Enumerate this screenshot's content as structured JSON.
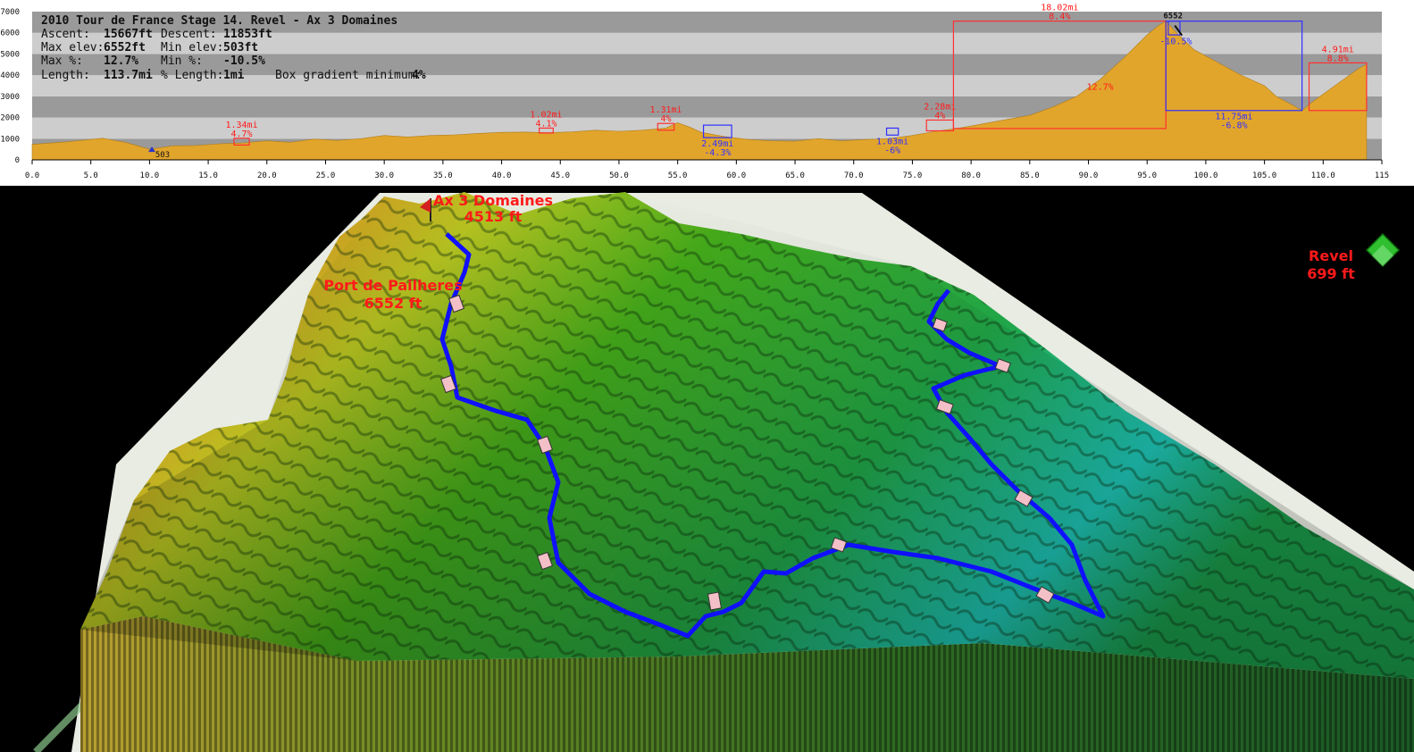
{
  "colors": {
    "profile_fill": "#e2a52c",
    "band_dark": "#9a9a9a",
    "band_light": "#cdcdcd",
    "climb_box": "#ff3030",
    "descent_box": "#3030ff",
    "label_red": "#ff1a1a",
    "route": "#1010ff"
  },
  "summary": {
    "ascent_label": "Ascent:",
    "ascent_value": "15667ft",
    "descent_label": "Descent:",
    "descent_value": "11853ft",
    "max_elev_label": "Max elev:",
    "max_elev_value": "6552ft",
    "min_elev_label": "Min elev:",
    "min_elev_value": "503ft",
    "max_pct_label": "Max %:",
    "max_pct_value": "12.7%",
    "min_pct_label": "Min %:",
    "min_pct_value": "-10.5%",
    "length_label": "Length:",
    "length_value": "113.7mi",
    "pct_length_label": "% Length:",
    "pct_length_value": "1mi",
    "box_min_label": "Box gradient minimum:",
    "box_min_value": "4%"
  },
  "chart_data": {
    "type": "area",
    "title": "2010 Tour de France Stage 14. Revel - Ax 3 Domaines",
    "xlim": [
      0,
      115
    ],
    "ylim": [
      0,
      7000
    ],
    "x_ticks": [
      "0.0",
      "5.0",
      "10.0",
      "15.0",
      "20.0",
      "25.0",
      "30.0",
      "35.0",
      "40.0",
      "45.0",
      "50.0",
      "55.0",
      "60.0",
      "65.0",
      "70.0",
      "75.0",
      "80.0",
      "85.0",
      "90.0",
      "95.0",
      "100.0",
      "105.0",
      "110.0",
      "115"
    ],
    "y_ticks": [
      "0",
      "1000",
      "2000",
      "3000",
      "4000",
      "5000",
      "6000",
      "7000"
    ],
    "grid": "horizontal bands",
    "series": [
      {
        "x": [
          0,
          3,
          6,
          8,
          10,
          12,
          14,
          16,
          18,
          20,
          22,
          24,
          26,
          28,
          30,
          32,
          34,
          36,
          38,
          40,
          42,
          44,
          46,
          48,
          50,
          52,
          54,
          55,
          56,
          57,
          59,
          61,
          63,
          65,
          67,
          69,
          71,
          73,
          75,
          77,
          79,
          81,
          83,
          85,
          87,
          89,
          91,
          93,
          95,
          96,
          96.6,
          97.5,
          99,
          101,
          103,
          105,
          106,
          107,
          108.2,
          109,
          110,
          111,
          112,
          113,
          113.7
        ],
        "y": [
          730,
          850,
          1020,
          820,
          503,
          660,
          680,
          760,
          800,
          900,
          830,
          980,
          920,
          1000,
          1150,
          1080,
          1150,
          1180,
          1250,
          1300,
          1310,
          1280,
          1320,
          1400,
          1350,
          1400,
          1500,
          1750,
          1550,
          1300,
          1100,
          960,
          900,
          880,
          1000,
          900,
          960,
          1000,
          1150,
          1350,
          1500,
          1700,
          1900,
          2100,
          2500,
          3000,
          3800,
          4800,
          5900,
          6350,
          6552,
          6000,
          5200,
          4600,
          4000,
          3500,
          3000,
          2700,
          2330,
          2700,
          3100,
          3500,
          3900,
          4300,
          4513
        ]
      }
    ],
    "annotations": {
      "low_point": {
        "x": 10.2,
        "label": "503"
      },
      "summit": {
        "x": 96.6,
        "y": 6552,
        "label": "6552"
      },
      "max_pct_mark": {
        "x": 91,
        "y": 3300,
        "label": "12.7%"
      },
      "boxes": [
        {
          "kind": "climb",
          "x0": 17.2,
          "x1": 18.5,
          "y0": 700,
          "y1": 1020,
          "line1": "1.34mi",
          "line2": "4.7%"
        },
        {
          "kind": "climb",
          "x0": 43.2,
          "x1": 44.4,
          "y0": 1270,
          "y1": 1500,
          "line1": "1.02mi",
          "line2": "4.1%"
        },
        {
          "kind": "climb",
          "x0": 53.3,
          "x1": 54.7,
          "y0": 1400,
          "y1": 1720,
          "line1": "1.31mi",
          "line2": "4%"
        },
        {
          "kind": "descent",
          "x0": 57.2,
          "x1": 59.6,
          "y0": 1050,
          "y1": 1640,
          "line1": "2.49mi",
          "line2": "-4.3%"
        },
        {
          "kind": "descent",
          "x0": 72.8,
          "x1": 73.8,
          "y0": 1170,
          "y1": 1500,
          "line1": "1.03mi",
          "line2": "-6%"
        },
        {
          "kind": "climb",
          "x0": 76.2,
          "x1": 78.5,
          "y0": 1370,
          "y1": 1880,
          "line1": "2.28mi",
          "line2": "4%"
        },
        {
          "kind": "climb",
          "x0": 78.5,
          "x1": 96.6,
          "y0": 1480,
          "y1": 6552,
          "line1": "18.02mi",
          "line2": "8.4%"
        },
        {
          "kind": "descent",
          "x0": 96.6,
          "x1": 108.2,
          "y0": 2330,
          "y1": 6552,
          "line1": "11.75mi",
          "line2": "-6.8%"
        },
        {
          "kind": "descent_steep",
          "x0": 96.8,
          "x1": 97.8,
          "y0": 5900,
          "y1": 6552,
          "line1": "",
          "line2": "-10.5%"
        },
        {
          "kind": "climb",
          "x0": 108.8,
          "x1": 113.7,
          "y0": 2330,
          "y1": 4580,
          "line1": "4.91mi",
          "line2": "8.8%"
        }
      ]
    }
  },
  "map": {
    "finish_name": "Ax 3 Domaines",
    "finish_elev": "4513 ft",
    "summit_name": "Port de Pailheres",
    "summit_elev": "6552 ft",
    "start_name": "Revel",
    "start_elev": "699 ft"
  }
}
